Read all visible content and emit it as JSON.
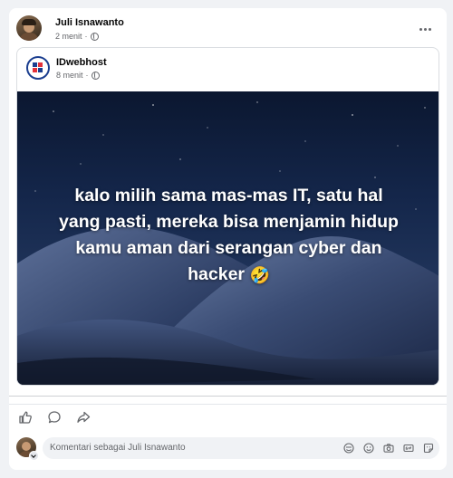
{
  "post": {
    "author": "Juli Isnawanto",
    "time": "2 menit",
    "separator": "·"
  },
  "shared_post": {
    "page_name": "IDwebhost",
    "time": "8 menit",
    "separator": "·",
    "image_text_lines": [
      "kalo milih sama mas-mas IT, satu hal",
      "yang pasti, mereka bisa menjamin hidup",
      "kamu aman dari serangan cyber dan",
      "hacker"
    ],
    "image_emoji": "🤣"
  },
  "comment": {
    "placeholder": "Komentari sebagai Juli Isnawanto"
  },
  "icons": {
    "more": "more-horizontal-icon",
    "privacy": "globe-icon",
    "like": "thumbs-up-icon",
    "comment": "comment-bubble-icon",
    "share": "share-arrow-icon",
    "tools": [
      "avatar-sticker-icon",
      "emoji-icon",
      "camera-icon",
      "gif-icon",
      "sticker-icon"
    ]
  },
  "colors": {
    "accent": "#1b3e8f",
    "secondary_text": "#65676b",
    "background": "#f0f2f5"
  }
}
